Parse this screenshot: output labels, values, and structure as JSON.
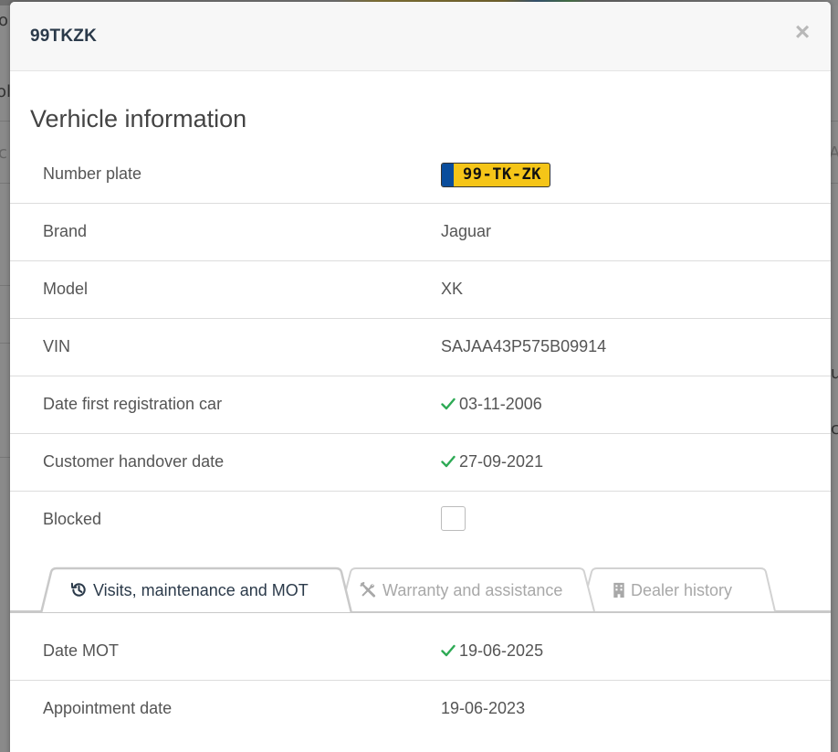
{
  "modal": {
    "title": "99TKZK",
    "close_label": "×"
  },
  "section": {
    "title": "Verhicle information"
  },
  "vehicle": {
    "number_plate_label": "Number plate",
    "number_plate_value": "99-TK-ZK",
    "brand_label": "Brand",
    "brand_value": "Jaguar",
    "model_label": "Model",
    "model_value": "XK",
    "vin_label": "VIN",
    "vin_value": "SAJAA43P575B09914",
    "first_registration_label": "Date first registration car",
    "first_registration_value": "03-11-2006",
    "handover_label": "Customer handover date",
    "handover_value": "27-09-2021",
    "blocked_label": "Blocked",
    "blocked_checked": false
  },
  "tabs": [
    {
      "label": "Visits, maintenance and MOT",
      "icon": "history-icon",
      "active": true
    },
    {
      "label": "Warranty and assistance",
      "icon": "tools-icon",
      "active": false
    },
    {
      "label": "Dealer history",
      "icon": "building-icon",
      "active": false
    }
  ],
  "visits": {
    "mot_label": "Date MOT",
    "mot_value": "19-06-2025",
    "appointment_label": "Appointment date",
    "appointment_value": "19-06-2023"
  },
  "colors": {
    "check": "#2eaa55",
    "plate_yellow": "#f5c518",
    "plate_blue": "#0a4d9c",
    "title": "#2b3a4a"
  }
}
